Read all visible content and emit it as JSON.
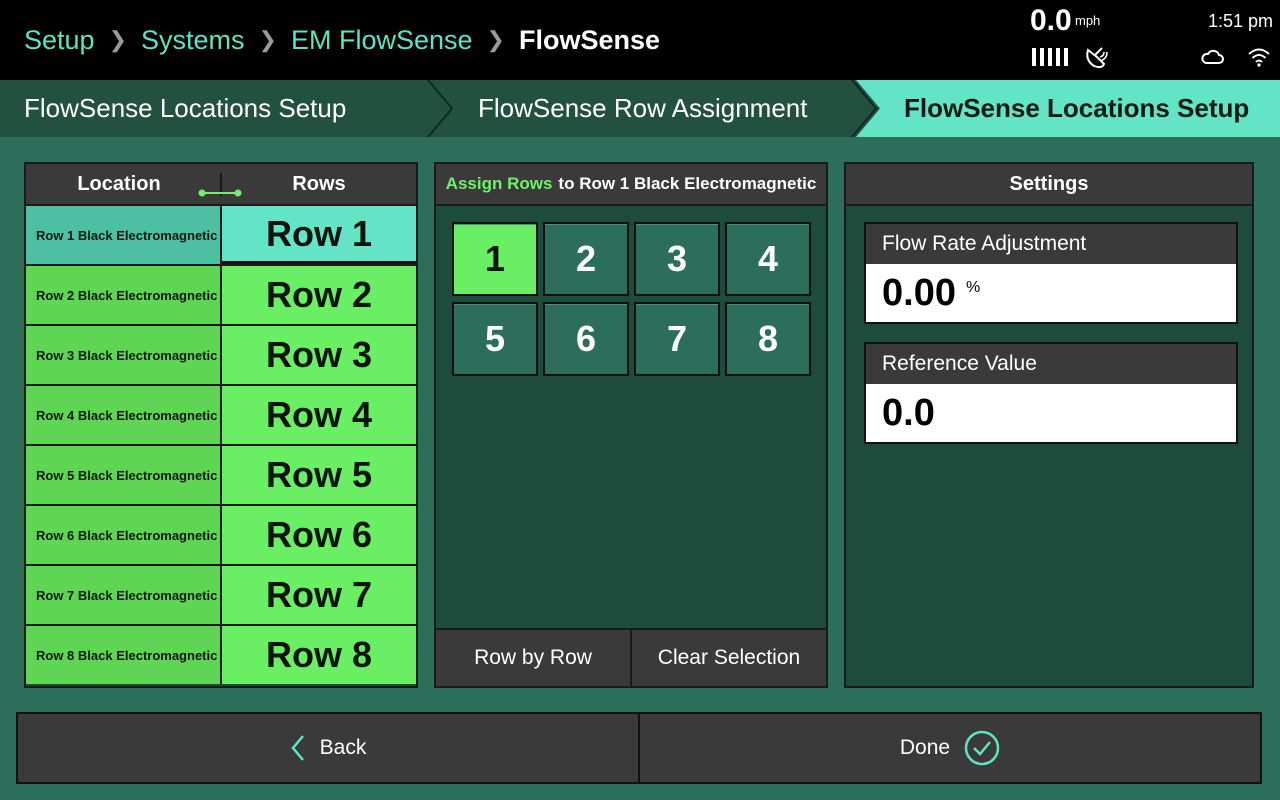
{
  "breadcrumb": [
    "Setup",
    "Systems",
    "EM FlowSense",
    "FlowSense"
  ],
  "status": {
    "speed": "0.0",
    "speed_unit": "mph",
    "time": "1:51 pm"
  },
  "tabs": [
    "FlowSense Locations Setup",
    "FlowSense Row Assignment",
    "FlowSense Locations Setup"
  ],
  "active_tab": 2,
  "locations": {
    "header_location": "Location",
    "header_rows": "Rows",
    "items": [
      {
        "location": "Row 1 Black Electromagnetic",
        "row": "Row 1",
        "selected": true
      },
      {
        "location": "Row 2 Black Electromagnetic",
        "row": "Row 2"
      },
      {
        "location": "Row 3 Black Electromagnetic",
        "row": "Row 3"
      },
      {
        "location": "Row 4 Black Electromagnetic",
        "row": "Row 4"
      },
      {
        "location": "Row 5 Black Electromagnetic",
        "row": "Row 5"
      },
      {
        "location": "Row 6 Black Electromagnetic",
        "row": "Row 6"
      },
      {
        "location": "Row 7 Black Electromagnetic",
        "row": "Row 7"
      },
      {
        "location": "Row 8 Black Electromagnetic",
        "row": "Row 8"
      }
    ]
  },
  "assign": {
    "title_highlight": "Assign Rows",
    "title_rest": "to Row 1 Black Electromagnetic",
    "numbers": [
      "1",
      "2",
      "3",
      "4",
      "5",
      "6",
      "7",
      "8"
    ],
    "selected_number": "1",
    "row_by_row": "Row by Row",
    "clear_selection": "Clear Selection"
  },
  "settings": {
    "title": "Settings",
    "flow_rate_label": "Flow Rate Adjustment",
    "flow_rate_value": "0.00",
    "flow_rate_unit": "%",
    "reference_label": "Reference Value",
    "reference_value": "0.0"
  },
  "footer": {
    "back": "Back",
    "done": "Done"
  },
  "colors": {
    "accent_teal": "#5fe3c2",
    "active_green": "#6aee64",
    "background": "#2c6e59"
  },
  "icons": [
    "satellite-icon",
    "cloud-icon",
    "wifi-icon",
    "link-icon",
    "chevron-left-icon",
    "check-circle-icon"
  ]
}
